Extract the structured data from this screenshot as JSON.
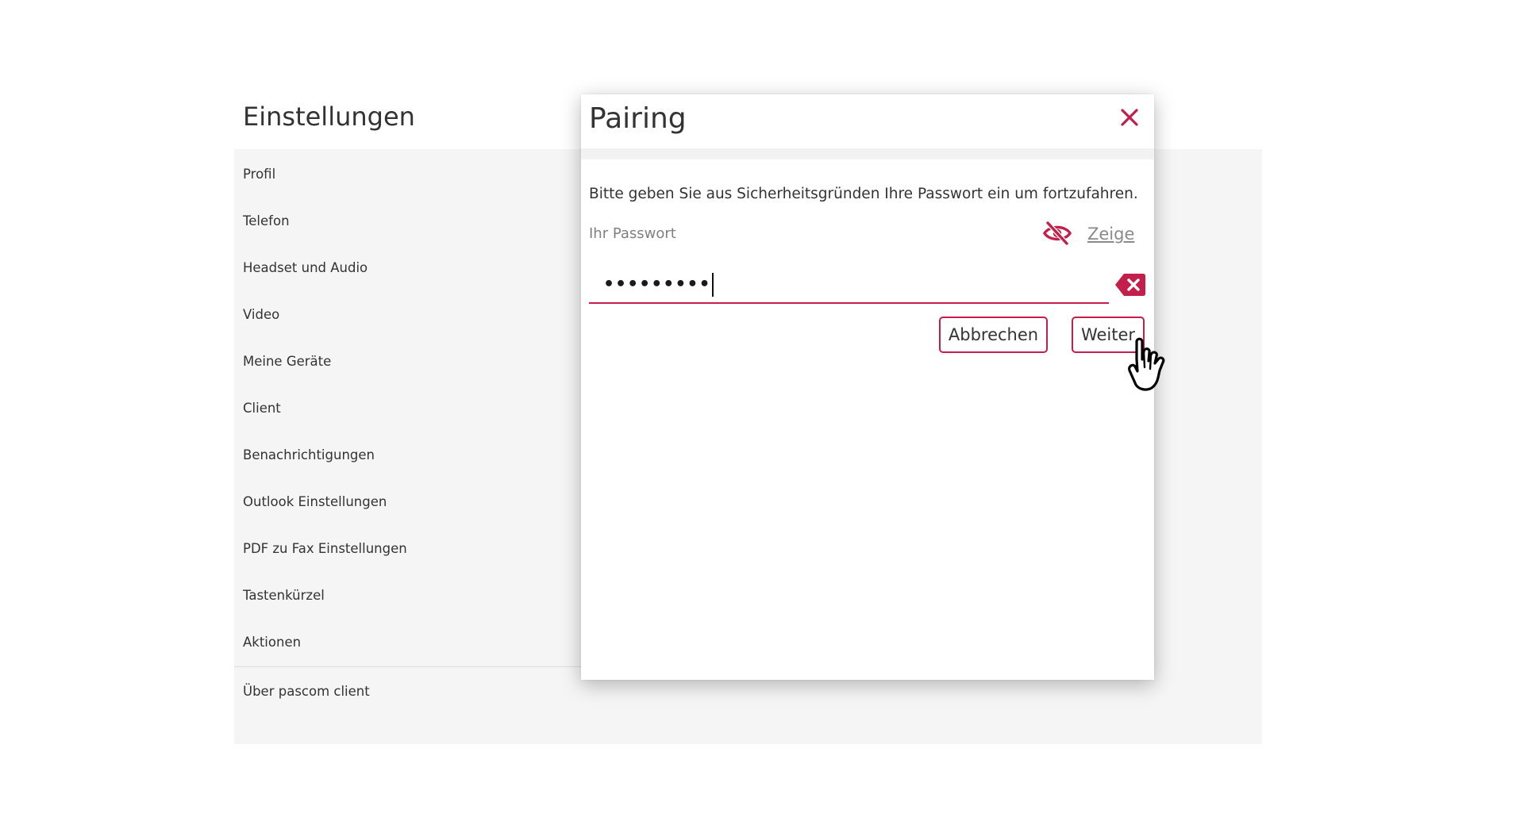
{
  "settings": {
    "title": "Einstellungen",
    "items": [
      {
        "label": "Profil"
      },
      {
        "label": "Telefon"
      },
      {
        "label": "Headset und Audio"
      },
      {
        "label": "Video"
      },
      {
        "label": "Meine Geräte"
      },
      {
        "label": "Client"
      },
      {
        "label": "Benachrichtigungen"
      },
      {
        "label": "Outlook Einstellungen"
      },
      {
        "label": "PDF zu Fax Einstellungen"
      },
      {
        "label": "Tastenkürzel"
      },
      {
        "label": "Aktionen"
      }
    ],
    "about_label": "Über pascom client"
  },
  "dialog": {
    "title": "Pairing",
    "close_icon": "close-icon",
    "message": "Bitte geben Sie aus Sicherheitsgründen Ihre Passwort ein um fortzufahren.",
    "password_label": "Ihr Passwort",
    "show_label": "Zeige",
    "visibility_icon": "eye-slash-icon",
    "password_value": "•••••••••",
    "clear_icon": "backspace-clear-icon",
    "cancel_label": "Abbrechen",
    "next_label": "Weiter"
  },
  "colors": {
    "accent": "#c41e4a",
    "panel_bg": "#f5f5f5",
    "text": "#333333",
    "muted": "#808080"
  }
}
